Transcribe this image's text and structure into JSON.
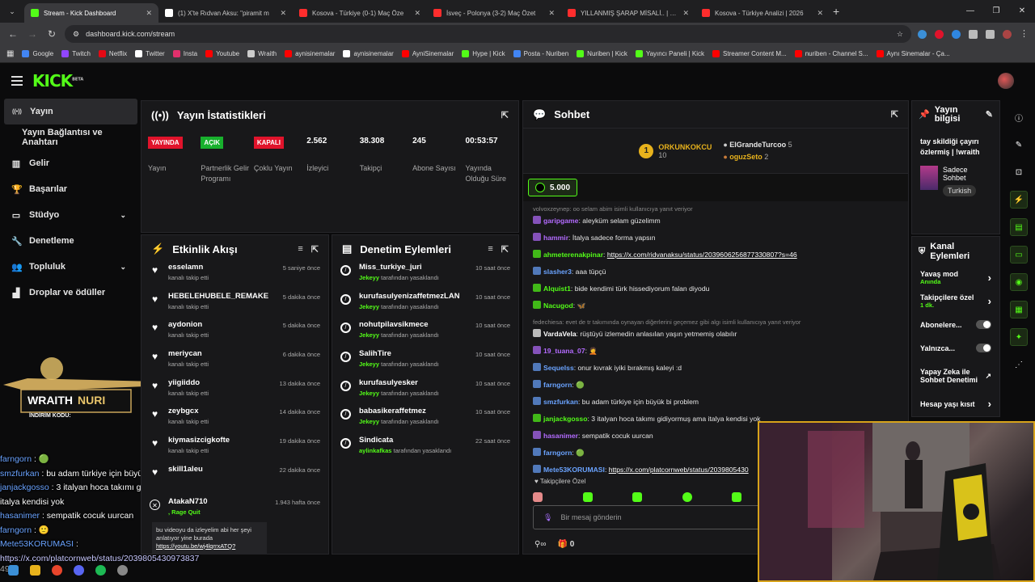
{
  "browser": {
    "tabs": [
      {
        "title": "Stream - Kick Dashboard",
        "active": true,
        "fav": "#53fc18"
      },
      {
        "title": "(1) X'te Rıdvan Aksu: \"piramit m",
        "active": false,
        "fav": "#ffffff"
      },
      {
        "title": "Kosova - Türkiye (0-1) Maç Öze",
        "active": false,
        "fav": "#ff2d2d"
      },
      {
        "title": "İsveç - Polonya (3-2) Maç Özet",
        "active": false,
        "fav": "#ff2d2d"
      },
      {
        "title": "YILLANMIŞ ŞARAP MİSALİ.. | LC",
        "active": false,
        "fav": "#ff2d2d"
      },
      {
        "title": "Kosova - Türkiye Analizi | 2026",
        "active": false,
        "fav": "#ff2d2d"
      }
    ],
    "url": "dashboard.kick.com/stream",
    "bookmarks": [
      {
        "label": "Google",
        "color": "#4285f4"
      },
      {
        "label": "Twitch",
        "color": "#9146ff"
      },
      {
        "label": "Netflix",
        "color": "#e50914"
      },
      {
        "label": "Twitter",
        "color": "#ffffff"
      },
      {
        "label": "Insta",
        "color": "#e1306c"
      },
      {
        "label": "Youtube",
        "color": "#ff0000"
      },
      {
        "label": "Wraith",
        "color": "#cccccc"
      },
      {
        "label": "aynisinemalar",
        "color": "#ff0000"
      },
      {
        "label": "aynisinemalar",
        "color": "#ffffff"
      },
      {
        "label": "AyniSinemalar",
        "color": "#ff0000"
      },
      {
        "label": "Hype | Kick",
        "color": "#53fc18"
      },
      {
        "label": "Posta - Nuriben",
        "color": "#4285f4"
      },
      {
        "label": "Nuriben | Kick",
        "color": "#53fc18"
      },
      {
        "label": "Yayıncı Paneli | Kick",
        "color": "#53fc18"
      },
      {
        "label": "Streamer Content M...",
        "color": "#ff0000"
      },
      {
        "label": "nuriben - Channel S...",
        "color": "#ff0000"
      },
      {
        "label": "Aynı Sinemalar - Ça...",
        "color": "#ff0000"
      }
    ]
  },
  "sidebar": {
    "items": [
      {
        "label": "Yayın",
        "icon": "broadcast-icon",
        "active": true
      },
      {
        "label": "Yayın Bağlantısı ve Anahtarı",
        "icon": "",
        "active": false
      },
      {
        "label": "Gelir",
        "icon": "chart-icon",
        "active": false
      },
      {
        "label": "Başarılar",
        "icon": "trophy-icon",
        "active": false
      },
      {
        "label": "Stüdyo",
        "icon": "studio-icon",
        "active": false,
        "chevron": true
      },
      {
        "label": "Denetleme",
        "icon": "wrench-icon",
        "active": false
      },
      {
        "label": "Topluluk",
        "icon": "people-icon",
        "active": false,
        "chevron": true
      },
      {
        "label": "Droplar ve ödüller",
        "icon": "gift-icon",
        "active": false
      }
    ]
  },
  "stats": {
    "title": "Yayın İstatistikleri",
    "items": [
      {
        "badge": "YAYINDA",
        "badge_color": "#e0132b",
        "label": "Yayın"
      },
      {
        "badge": "AÇIK",
        "badge_color": "#18b02d",
        "label": "Partnerlik Gelir Programı"
      },
      {
        "badge": "KAPALI",
        "badge_color": "#e0132b",
        "label": "Çoklu Yayın"
      },
      {
        "num": "2.562",
        "label": "İzleyici"
      },
      {
        "num": "38.308",
        "label": "Takipçi"
      },
      {
        "num": "245",
        "label": "Abone Sayısı"
      },
      {
        "num": "00:53:57",
        "label": "Yayında Olduğu Süre"
      }
    ]
  },
  "activity": {
    "title": "Etkinlik Akışı",
    "items": [
      {
        "name": "esselamn",
        "sub": "kanalı takip etti",
        "time": "5 saniye önce"
      },
      {
        "name": "HEBELEHUBELE_REMAKE",
        "sub": "kanalı takip etti",
        "time": "5 dakika önce"
      },
      {
        "name": "aydonion",
        "sub": "kanalı takip etti",
        "time": "5 dakika önce"
      },
      {
        "name": "meriycan",
        "sub": "kanalı takip etti",
        "time": "6 dakika önce"
      },
      {
        "name": "yiigiiddo",
        "sub": "kanalı takip etti",
        "time": "13 dakika önce"
      },
      {
        "name": "zeybgcx",
        "sub": "kanalı takip etti",
        "time": "14 dakika önce"
      },
      {
        "name": "kiymasizcigkofte",
        "sub": "kanalı takip etti",
        "time": "19 dakika önce"
      },
      {
        "name": "skill1aleu",
        "sub": "",
        "time": "22 dakika önce"
      }
    ],
    "special": {
      "name": "AtakaN710",
      "sub": ", Rage Quit",
      "time": "1.943 hafta önce",
      "msg": "bu videoyu da izleyelim abi her şeyi anlatıyor yine burada",
      "link": "https://youtu.be/wj4lqrrxATQ?"
    }
  },
  "moderation": {
    "title": "Denetim Eylemleri",
    "items": [
      {
        "name": "Miss_turkiye_juri",
        "by": "Jekeyy",
        "sub": "tarafından yasaklandı",
        "time": "10 saat önce"
      },
      {
        "name": "kurufasulyenizaffetmezLAN",
        "by": "Jekeyy",
        "sub": "tarafından yasaklandı",
        "time": "10 saat önce"
      },
      {
        "name": "nohutpilavsikmece",
        "by": "Jekeyy",
        "sub": "tarafından yasaklandı",
        "time": "10 saat önce"
      },
      {
        "name": "SalihTire",
        "by": "Jekeyy",
        "sub": "tarafından yasaklandı",
        "time": "10 saat önce"
      },
      {
        "name": "kurufasulyesker",
        "by": "Jekeyy",
        "sub": "tarafından yasaklandı",
        "time": "10 saat önce"
      },
      {
        "name": "babasikeraffetmez",
        "by": "Jekeyy",
        "sub": "tarafından yasaklandı",
        "time": "10 saat önce"
      },
      {
        "name": "Sindicata",
        "by": "aylinkafkas",
        "sub": "tarafından yasaklandı",
        "time": "22 saat önce"
      }
    ]
  },
  "chat": {
    "title": "Sohbet",
    "leaders": {
      "first": "ORKUNKOKCU",
      "first_val": "10",
      "second": "ElGrandeTurcoo",
      "second_val": "5",
      "third": "oguzSeto",
      "third_val": "2"
    },
    "pinned_amount": "5.000",
    "messages": [
      {
        "reply": "volvoxzeynep: oo selam abim isimli kullanıcıya yanıt veriyor",
        "user": "garipgame",
        "color": "#b36bff",
        "text": "aleyküm selam güzelimm"
      },
      {
        "user": "hammir",
        "color": "#b36bff",
        "text": "İtalya sadece forma yapsın"
      },
      {
        "user": "ahmeterenakpinar",
        "color": "#53fc18",
        "text": "",
        "link": "https://x.com/ridvanaksu/status/2039606256877330807?s=46"
      },
      {
        "user": "slasher3",
        "color": "#6aa3ff",
        "text": "aaa tüpçü"
      },
      {
        "user": "Alquist1",
        "color": "#53fc18",
        "text": "bide kendimi türk hissediyorum falan diyodu"
      },
      {
        "user": "Nacugod",
        "color": "#53fc18",
        "text": "🦋"
      },
      {
        "reply": "fedechiesa: evet de tr takımında oynayan diğerlerini geçemez gibi algı isimli kullanıcıya yanıt veriyor",
        "user": "VardaVela",
        "color": "#ffffff",
        "text": "rüştüyü izlemedin anlasılan yaşın yetmemiş olabılır"
      },
      {
        "user": "19_tuana_07",
        "color": "#b36bff",
        "text": "🤦"
      },
      {
        "user": "Sequelss",
        "color": "#6aa3ff",
        "text": "onur kıvrak iyiki bırakmış kaleyi :d"
      },
      {
        "user": "farngorn",
        "color": "#6aa3ff",
        "text": "🟢"
      },
      {
        "user": "smzfurkan",
        "color": "#6aa3ff",
        "text": "bu adam türkiye için büyük bi problem"
      },
      {
        "user": "janjackgosso",
        "color": "#53fc18",
        "text": "3 italyan hoca takımı gidiyormuş ama italya kendisi yok"
      },
      {
        "user": "hasanimer",
        "color": "#b36bff",
        "text": "sempatik cocuk uurcan"
      },
      {
        "user": "farngorn",
        "color": "#6aa3ff",
        "text": "🟢"
      },
      {
        "user": "Mete53KORUMASI",
        "color": "#6aa3ff",
        "text": "",
        "link": "https://x.com/platcornweb/status/2039805430"
      }
    ],
    "subs_label": "Takipçilere Özel",
    "placeholder": "Bir mesaj gönderin",
    "count": "0"
  },
  "info": {
    "title": "Yayın bilgisi",
    "stream_title": "tay skildiği çayırı özlermiş | !wraith",
    "category": "Sadece Sohbet",
    "lang": "Turkish"
  },
  "channel_actions": {
    "title": "Kanal Eylemleri",
    "items": [
      {
        "label": "Yavaş mod",
        "sub": "Anında",
        "type": "chev"
      },
      {
        "label": "Takipçilere özel",
        "sub": "1 dk.",
        "type": "chev"
      },
      {
        "label": "Abonelere...",
        "sub": "",
        "type": "toggle"
      },
      {
        "label": "Yalnızca...",
        "sub": "",
        "type": "toggle"
      },
      {
        "label": "Yapay Zeka ile Sohbet Denetimi",
        "sub": "",
        "type": "ext"
      },
      {
        "label": "Hesap yaşı kısıt",
        "sub": "",
        "type": "chev"
      }
    ]
  },
  "overlay": {
    "promo_top": "WRAITH",
    "promo_code": "NURI",
    "promo_sub": "İNDİRİM KODU:",
    "lines": [
      {
        "user": "farngorn",
        "text": "🟢"
      },
      {
        "user": "smzfurkan",
        "text": "bu adam türkiye için büyük bi problem"
      },
      {
        "user": "janjackgosso",
        "text": "3 italyan hoca takımı gidiyormuş ama italya kendisi yok"
      },
      {
        "user": "hasanimer",
        "text": "sempatik cocuk uurcan"
      },
      {
        "user": "farngorn",
        "text": "🙂"
      },
      {
        "user": "Mete53KORUMASI",
        "text": ""
      }
    ],
    "link": "https://x.com/platcornweb/status/2039805430973837",
    "tail": "49"
  }
}
